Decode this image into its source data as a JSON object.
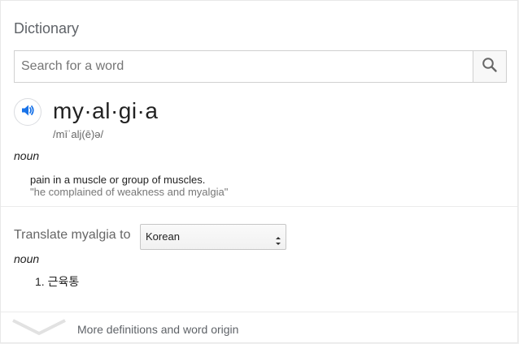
{
  "card": {
    "title": "Dictionary"
  },
  "search": {
    "placeholder": "Search for a word",
    "value": ""
  },
  "entry": {
    "word": "my·al·gi·a",
    "phonetic": "/mīˈalj(ē)ə/",
    "part_of_speech": "noun",
    "definition": "pain in a muscle or group of muscles.",
    "example": "\"he complained of weakness and myalgia\""
  },
  "translate": {
    "label": "Translate myalgia to",
    "selected_language": "Korean",
    "part_of_speech": "noun",
    "items": [
      "1. 근육통"
    ]
  },
  "footer": {
    "more_label": "More definitions and word origin"
  },
  "colors": {
    "accent": "#1a73e8",
    "divider": "#ebebeb"
  }
}
